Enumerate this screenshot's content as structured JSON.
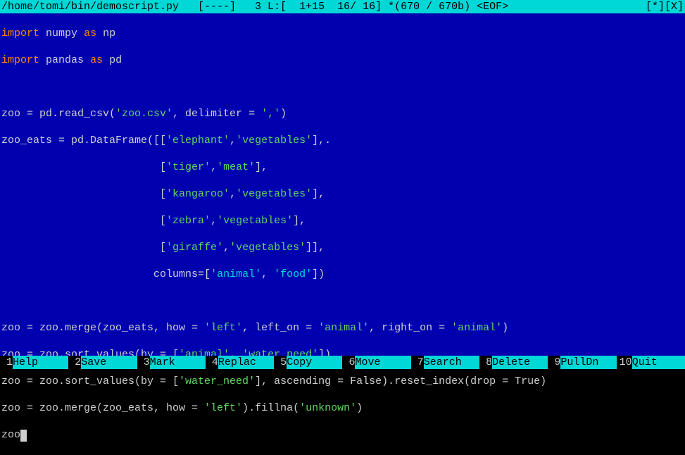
{
  "topbar": {
    "left": "/home/tomi/bin/demoscript.py   [----]   3 L:[  1+15  16/ 16] *(670 / 670b) <EOF>",
    "right": "[*][X]"
  },
  "code": {
    "l1_import": "import",
    "l1_numpy": "numpy",
    "l1_as": "as",
    "l1_np": "np",
    "l2_import": "import",
    "l2_pandas": "pandas",
    "l2_as": "as",
    "l2_pd": "pd",
    "l4_a": "zoo = pd.read_csv(",
    "l4_s": "'zoo.csv'",
    "l4_b": ", delimiter = ",
    "l4_s2": "','",
    "l4_c": ")",
    "l5_a": "zoo_eats = pd.DataFrame([[",
    "l5_s1": "'elephant'",
    "l5_comma": ",",
    "l5_s2": "'vegetables'",
    "l5_b": "],.",
    "l6_pad": "                         [",
    "l6_s1": "'tiger'",
    "l6_comma": ",",
    "l6_s2": "'meat'",
    "l6_end": "],",
    "l7_pad": "                         [",
    "l7_s1": "'kangaroo'",
    "l7_comma": ",",
    "l7_s2": "'vegetables'",
    "l7_end": "],",
    "l8_pad": "                         [",
    "l8_s1": "'zebra'",
    "l8_comma": ",",
    "l8_s2": "'vegetables'",
    "l8_end": "],",
    "l9_pad": "                         [",
    "l9_s1": "'giraffe'",
    "l9_comma": ",",
    "l9_s2": "'vegetables'",
    "l9_end": "]],",
    "l10_a": "                        columns=[",
    "l10_s1": "'animal'",
    "l10_comma": ", ",
    "l10_s2": "'food'",
    "l10_end": "])",
    "l12_a": "zoo = zoo.merge(zoo_eats, how = ",
    "l12_s1": "'left'",
    "l12_b": ", left_on = ",
    "l12_s2": "'animal'",
    "l12_c": ", right_on = ",
    "l12_s3": "'animal'",
    "l12_end": ")",
    "l13_a": "zoo = zoo.sort_values(by = [",
    "l13_s1": "'animal'",
    "l13_comma": ", ",
    "l13_s2": "'water_need'",
    "l13_end": "])",
    "l14_a": "zoo = zoo.sort_values(by = [",
    "l14_s1": "'water_need'",
    "l14_b": "], ascending = False).reset_index(drop = True)",
    "l15_a": "zoo = zoo.merge(zoo_eats, how = ",
    "l15_s1": "'left'",
    "l15_b": ").fillna(",
    "l15_s2": "'unknown'",
    "l15_end": ")",
    "l16": "zoo"
  },
  "footer": {
    "keys": [
      {
        "num": "1",
        "label": "Help"
      },
      {
        "num": "2",
        "label": "Save"
      },
      {
        "num": "3",
        "label": "Mark"
      },
      {
        "num": "4",
        "label": "Replac"
      },
      {
        "num": "5",
        "label": "Copy"
      },
      {
        "num": "6",
        "label": "Move"
      },
      {
        "num": "7",
        "label": "Search"
      },
      {
        "num": "8",
        "label": "Delete"
      },
      {
        "num": "9",
        "label": "PullDn"
      },
      {
        "num": "10",
        "label": "Quit"
      }
    ]
  }
}
